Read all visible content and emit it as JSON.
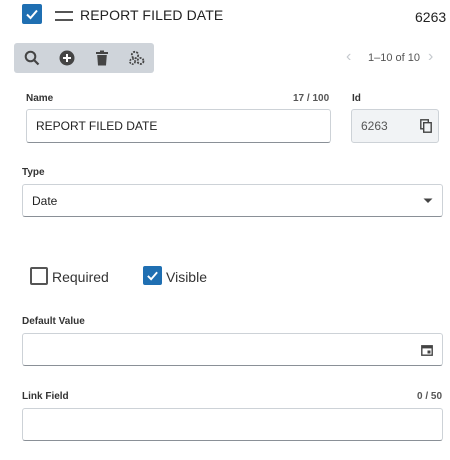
{
  "header": {
    "title": "REPORT FILED DATE",
    "id": "6263",
    "selected": true
  },
  "toolbar": {
    "pager": "1–10 of 10"
  },
  "form": {
    "name": {
      "label": "Name",
      "counter": "17 / 100",
      "value": "REPORT FILED DATE"
    },
    "id": {
      "label": "Id",
      "value": "6263"
    },
    "type": {
      "label": "Type",
      "value": "Date"
    },
    "required": {
      "label": "Required",
      "checked": false
    },
    "visible": {
      "label": "Visible",
      "checked": true
    },
    "default_value": {
      "label": "Default Value",
      "value": ""
    },
    "link_field": {
      "label": "Link Field",
      "counter": "0 / 50",
      "value": ""
    }
  },
  "colors": {
    "accent": "#1f6fb2",
    "toolbar_bg": "#cfd4da"
  }
}
